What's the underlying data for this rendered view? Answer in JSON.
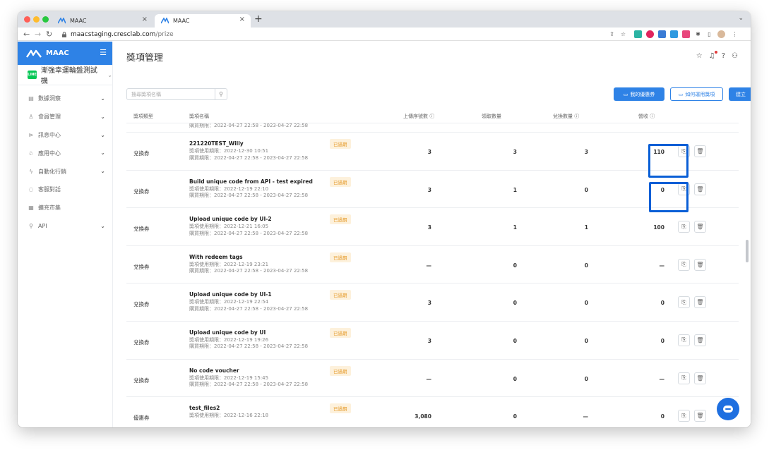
{
  "browser": {
    "tabs": [
      {
        "title": "MAAC",
        "close": "×"
      },
      {
        "title": "MAAC",
        "close": "×"
      }
    ],
    "new_tab": "+",
    "tab_menu": "⌄",
    "url_host": "maacstaging.cresclab.com",
    "url_path": "/prize"
  },
  "sidebar": {
    "brand": "MAAC",
    "account_name": "漸強幸運輪盤測試機",
    "line_badge": "LINE",
    "items": [
      {
        "label": "數據洞察",
        "icon": "chart-icon",
        "has_chevron": true
      },
      {
        "label": "會員管理",
        "icon": "user-icon",
        "has_chevron": true
      },
      {
        "label": "訊息中心",
        "icon": "send-icon",
        "has_chevron": true
      },
      {
        "label": "應用中心",
        "icon": "apps-icon",
        "has_chevron": true
      },
      {
        "label": "自動化行銷",
        "icon": "lightning-icon",
        "has_chevron": true
      },
      {
        "label": "客服對話",
        "icon": "chat-icon",
        "has_chevron": false
      },
      {
        "label": "擴充市集",
        "icon": "store-icon",
        "has_chevron": false
      },
      {
        "label": "API",
        "icon": "api-icon",
        "has_chevron": true
      }
    ]
  },
  "header": {
    "title": "獎項管理"
  },
  "toolbar": {
    "search_placeholder": "搜尋獎項名稱",
    "my_coupons": "我的優惠券",
    "how_to_use": "如何運用獎項",
    "create": "建立"
  },
  "table": {
    "headers": {
      "type": "獎項類型",
      "name": "獎項名稱",
      "serials": "上傳序號數",
      "claimed": "領取數量",
      "redeemed": "兌換數量",
      "revenue": "營收"
    },
    "partial_row_text": "購買期限：2022-04-27 22:58 - 2023-04-27 22:58",
    "rows": [
      {
        "type": "兌換券",
        "name": "221220TEST_Willy",
        "use_period": "獎項使用期限：2022-12-30 10:51",
        "buy_period": "購買期限：2022-04-27 22:58 - 2023-04-27 22:58",
        "badge": "已過期",
        "serials": "3",
        "claimed": "3",
        "redeemed": "3",
        "revenue": "110"
      },
      {
        "type": "兌換券",
        "name": "Build unique code from API - test expired",
        "use_period": "獎項使用期限：2022-12-19 22:10",
        "buy_period": "購買期限：2022-04-27 22:58 - 2023-04-27 22:58",
        "badge": "已過期",
        "serials": "3",
        "claimed": "1",
        "redeemed": "0",
        "revenue": "0"
      },
      {
        "type": "兌換券",
        "name": "Upload unique code by UI-2",
        "use_period": "獎項使用期限：2022-12-21 16:05",
        "buy_period": "購買期限：2022-04-27 22:58 - 2023-04-27 22:58",
        "badge": "已過期",
        "serials": "3",
        "claimed": "1",
        "redeemed": "1",
        "revenue": "100"
      },
      {
        "type": "兌換券",
        "name": "With redeem tags",
        "use_period": "獎項使用期限：2022-12-19 23:21",
        "buy_period": "購買期限：2022-04-27 22:58 - 2023-04-27 22:58",
        "badge": "已過期",
        "serials": "—",
        "claimed": "0",
        "redeemed": "0",
        "revenue": "—"
      },
      {
        "type": "兌換券",
        "name": "Upload unique code by UI-1",
        "use_period": "獎項使用期限：2022-12-19 22:54",
        "buy_period": "購買期限：2022-04-27 22:58 - 2023-04-27 22:58",
        "badge": "已過期",
        "serials": "3",
        "claimed": "0",
        "redeemed": "0",
        "revenue": "0"
      },
      {
        "type": "兌換券",
        "name": "Upload unique code by UI",
        "use_period": "獎項使用期限：2022-12-19 19:26",
        "buy_period": "購買期限：2022-04-27 22:58 - 2023-04-27 22:58",
        "badge": "已過期",
        "serials": "3",
        "claimed": "0",
        "redeemed": "0",
        "revenue": "0"
      },
      {
        "type": "兌換券",
        "name": "No code voucher",
        "use_period": "獎項使用期限：2022-12-19 15:45",
        "buy_period": "購買期限：2022-04-27 22:58 - 2023-04-27 22:58",
        "badge": "已過期",
        "serials": "—",
        "claimed": "0",
        "redeemed": "0",
        "revenue": "—"
      },
      {
        "type": "優惠券",
        "name": "test_files2",
        "use_period": "獎項使用期限：2022-12-16 22:18",
        "buy_period": "",
        "badge": "已過期",
        "serials": "3,080",
        "claimed": "0",
        "redeemed": "—",
        "revenue": "0"
      }
    ]
  },
  "colors": {
    "primary": "#2e82e6",
    "highlight": "#0a5fd6",
    "badge_bg": "#fdf1dc",
    "badge_text": "#e59a29"
  }
}
